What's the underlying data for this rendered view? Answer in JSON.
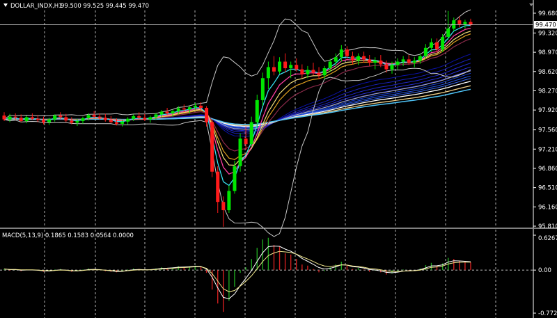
{
  "header": {
    "symbol_label": "DOLLAR_INDX,H1",
    "ohlc_label": "99.500 99.525 99.445 99.470"
  },
  "main_pane": {
    "y_ticks": [
      "99.680",
      "99.320",
      "98.970",
      "98.620",
      "98.270",
      "97.920",
      "97.560",
      "97.210",
      "96.860",
      "96.510",
      "96.160",
      "95.810"
    ],
    "current_price_label": "99.470",
    "ylim": [
      95.81,
      99.73
    ]
  },
  "macd_pane": {
    "label": "MACD(5,13,9) 0.1865 0.1583 0.0564 0.0000",
    "y_ticks": [
      "0.6267",
      "0.00",
      "-0.7729"
    ],
    "ylim": [
      -0.7729,
      0.6267
    ]
  },
  "colors": {
    "background": "#000000",
    "bull_candle": "#00e600",
    "bear_candle": "#ff1a1a",
    "grid_dash": "#ffffff",
    "text": "#ffffff"
  },
  "chart_data": [
    {
      "type": "candlestick",
      "title": "DOLLAR_INDX,H1",
      "ylim": [
        95.81,
        99.73
      ],
      "y_ticks": [
        99.68,
        99.32,
        98.97,
        98.62,
        98.27,
        97.92,
        97.56,
        97.21,
        96.86,
        96.51,
        96.16,
        95.81
      ],
      "last_price": 99.47,
      "ohlc": [
        [
          97.82,
          97.88,
          97.72,
          97.75
        ],
        [
          97.75,
          97.85,
          97.7,
          97.8
        ],
        [
          97.8,
          97.86,
          97.74,
          97.78
        ],
        [
          97.78,
          97.84,
          97.7,
          97.72
        ],
        [
          97.72,
          97.82,
          97.68,
          97.79
        ],
        [
          97.79,
          97.86,
          97.74,
          97.76
        ],
        [
          97.76,
          97.83,
          97.7,
          97.74
        ],
        [
          97.74,
          97.8,
          97.66,
          97.7
        ],
        [
          97.7,
          97.78,
          97.65,
          97.75
        ],
        [
          97.75,
          97.84,
          97.71,
          97.82
        ],
        [
          97.82,
          97.88,
          97.76,
          97.79
        ],
        [
          97.79,
          97.85,
          97.7,
          97.73
        ],
        [
          97.73,
          97.79,
          97.66,
          97.69
        ],
        [
          97.69,
          97.76,
          97.63,
          97.72
        ],
        [
          97.72,
          97.8,
          97.67,
          97.77
        ],
        [
          97.77,
          97.86,
          97.73,
          97.83
        ],
        [
          97.83,
          97.9,
          97.77,
          97.8
        ],
        [
          97.8,
          97.86,
          97.74,
          97.78
        ],
        [
          97.78,
          97.85,
          97.71,
          97.74
        ],
        [
          97.74,
          97.81,
          97.68,
          97.7
        ],
        [
          97.7,
          97.77,
          97.64,
          97.67
        ],
        [
          97.67,
          97.74,
          97.62,
          97.71
        ],
        [
          97.71,
          97.79,
          97.66,
          97.76
        ],
        [
          97.76,
          97.84,
          97.72,
          97.81
        ],
        [
          97.81,
          97.88,
          97.76,
          97.78
        ],
        [
          97.78,
          97.85,
          97.72,
          97.75
        ],
        [
          97.75,
          97.82,
          97.69,
          97.79
        ],
        [
          97.79,
          97.87,
          97.74,
          97.84
        ],
        [
          97.84,
          97.92,
          97.79,
          97.89
        ],
        [
          97.89,
          97.96,
          97.83,
          97.86
        ],
        [
          97.86,
          97.93,
          97.8,
          97.9
        ],
        [
          97.9,
          97.99,
          97.85,
          97.95
        ],
        [
          97.95,
          98.02,
          97.88,
          97.93
        ],
        [
          97.93,
          97.99,
          97.86,
          97.97
        ],
        [
          97.97,
          98.05,
          97.92,
          98.0
        ],
        [
          98.0,
          98.06,
          97.92,
          97.96
        ],
        [
          97.96,
          97.99,
          97.62,
          97.7
        ],
        [
          97.7,
          97.75,
          96.7,
          96.8
        ],
        [
          96.8,
          96.9,
          96.05,
          96.25
        ],
        [
          96.25,
          96.35,
          95.8,
          96.1
        ],
        [
          96.1,
          96.55,
          96.05,
          96.45
        ],
        [
          96.45,
          97.0,
          96.4,
          96.9
        ],
        [
          96.9,
          97.5,
          96.8,
          97.4
        ],
        [
          97.4,
          97.62,
          97.2,
          97.3
        ],
        [
          97.3,
          97.8,
          97.25,
          97.7
        ],
        [
          97.7,
          98.2,
          97.6,
          98.1
        ],
        [
          98.1,
          98.6,
          98.0,
          98.5
        ],
        [
          98.5,
          98.8,
          98.3,
          98.7
        ],
        [
          98.7,
          98.9,
          98.55,
          98.62
        ],
        [
          98.62,
          98.88,
          98.58,
          98.8
        ],
        [
          98.8,
          98.95,
          98.6,
          98.68
        ],
        [
          98.68,
          98.8,
          98.5,
          98.74
        ],
        [
          98.74,
          98.86,
          98.62,
          98.66
        ],
        [
          98.66,
          98.75,
          98.5,
          98.57
        ],
        [
          98.57,
          98.72,
          98.5,
          98.65
        ],
        [
          98.65,
          98.78,
          98.55,
          98.6
        ],
        [
          98.6,
          98.7,
          98.48,
          98.55
        ],
        [
          98.55,
          98.72,
          98.48,
          98.68
        ],
        [
          98.68,
          98.85,
          98.62,
          98.8
        ],
        [
          98.8,
          98.95,
          98.7,
          98.88
        ],
        [
          98.88,
          99.1,
          98.8,
          99.02
        ],
        [
          99.02,
          99.08,
          98.85,
          98.9
        ],
        [
          98.9,
          98.98,
          98.75,
          98.82
        ],
        [
          98.82,
          98.95,
          98.74,
          98.9
        ],
        [
          98.9,
          98.98,
          98.78,
          98.84
        ],
        [
          98.84,
          98.92,
          98.72,
          98.78
        ],
        [
          98.78,
          98.88,
          98.66,
          98.82
        ],
        [
          98.82,
          98.92,
          98.7,
          98.75
        ],
        [
          98.75,
          98.82,
          98.6,
          98.66
        ],
        [
          98.66,
          98.8,
          98.58,
          98.74
        ],
        [
          98.74,
          98.86,
          98.66,
          98.8
        ],
        [
          98.8,
          98.9,
          98.72,
          98.84
        ],
        [
          98.84,
          98.92,
          98.74,
          98.78
        ],
        [
          98.78,
          98.88,
          98.7,
          98.82
        ],
        [
          98.82,
          98.95,
          98.76,
          98.9
        ],
        [
          98.9,
          99.12,
          98.85,
          99.05
        ],
        [
          99.05,
          99.22,
          98.98,
          99.15
        ],
        [
          99.15,
          99.22,
          98.95,
          99.02
        ],
        [
          99.02,
          99.3,
          98.98,
          99.25
        ],
        [
          99.25,
          99.72,
          99.2,
          99.4
        ],
        [
          99.4,
          99.6,
          99.35,
          99.55
        ],
        [
          99.55,
          99.62,
          99.42,
          99.48
        ],
        [
          99.48,
          99.56,
          99.4,
          99.52
        ],
        [
          99.52,
          99.58,
          99.44,
          99.47
        ]
      ]
    },
    {
      "type": "bar",
      "title": "MACD(5,13,9) 0.1865 0.1583 0.0564 0.0000",
      "ylim": [
        -0.7729,
        0.6267
      ],
      "y_ticks": [
        0.6267,
        0.0,
        -0.7729
      ],
      "series": [
        {
          "values": [
            0.02,
            -0.01,
            0.01,
            -0.02,
            0.01,
            0.0,
            -0.01,
            -0.03,
            -0.02,
            0.01,
            0.02,
            -0.01,
            -0.03,
            -0.02,
            0.01,
            0.03,
            0.02,
            0.0,
            -0.02,
            -0.03,
            -0.04,
            -0.02,
            0.01,
            0.03,
            0.02,
            0.0,
            0.01,
            0.03,
            0.05,
            0.04,
            0.05,
            0.07,
            0.06,
            0.07,
            0.08,
            0.06,
            -0.05,
            -0.35,
            -0.6,
            -0.75,
            -0.55,
            -0.3,
            -0.05,
            0.05,
            0.2,
            0.4,
            0.55,
            0.58,
            0.45,
            0.42,
            0.3,
            0.28,
            0.2,
            0.1,
            0.08,
            0.02,
            -0.04,
            -0.02,
            0.05,
            0.1,
            0.15,
            0.08,
            0.02,
            0.04,
            0.01,
            -0.03,
            -0.01,
            -0.04,
            -0.08,
            -0.06,
            -0.02,
            0.01,
            -0.01,
            0.0,
            0.03,
            0.09,
            0.13,
            0.08,
            0.12,
            0.22,
            0.2,
            0.16,
            0.15,
            0.14
          ]
        }
      ]
    }
  ]
}
